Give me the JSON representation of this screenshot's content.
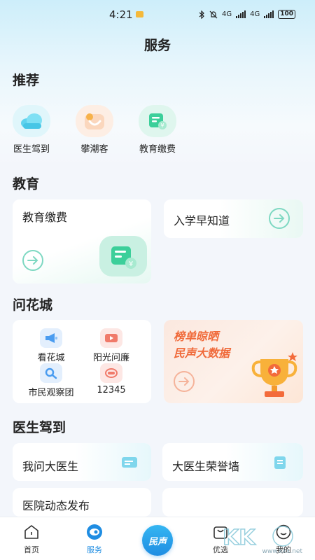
{
  "status_bar": {
    "time": "4:21",
    "battery": "100",
    "network1": "4G",
    "network2": "4G"
  },
  "page_title": "服务",
  "recommend": {
    "title": "推荐",
    "items": [
      {
        "label": "医生驾到",
        "icon": "cloud-icon"
      },
      {
        "label": "攀潮客",
        "icon": "crescent-moon-icon"
      },
      {
        "label": "教育缴费",
        "icon": "payment-bill-icon"
      }
    ]
  },
  "education": {
    "title": "教育",
    "fee_card": {
      "label": "教育缴费"
    },
    "admission_card": {
      "label": "入学早知道"
    }
  },
  "wenhuacheng": {
    "title": "问花城",
    "items": [
      {
        "label": "看花城",
        "icon": "megaphone-icon"
      },
      {
        "label": "阳光问廉",
        "icon": "video-play-icon"
      },
      {
        "label": "市民观察团",
        "icon": "magnifier-icon"
      },
      {
        "label": "12345",
        "icon": "hotline-icon"
      }
    ],
    "promo": {
      "line1": "榜单晾晒",
      "line2": "民声大数据"
    }
  },
  "doctor": {
    "title": "医生驾到",
    "cards": [
      {
        "label": "我问大医生"
      },
      {
        "label": "大医生荣誉墙"
      },
      {
        "label": "医院动态发布"
      }
    ]
  },
  "tab_bar": {
    "tabs": [
      {
        "label": "首页",
        "icon": "home-icon"
      },
      {
        "label": "服务",
        "icon": "service-icon",
        "active": true
      },
      {
        "label": "优选",
        "icon": "shopping-bag-icon"
      },
      {
        "label": "我的",
        "icon": "profile-icon"
      }
    ],
    "center_label": "民声"
  },
  "watermark": {
    "text": "www.kkx.net"
  },
  "colors": {
    "accent_blue": "#1f8de2",
    "accent_green": "#3ccf9a",
    "promo_orange": "#f06a3a"
  }
}
